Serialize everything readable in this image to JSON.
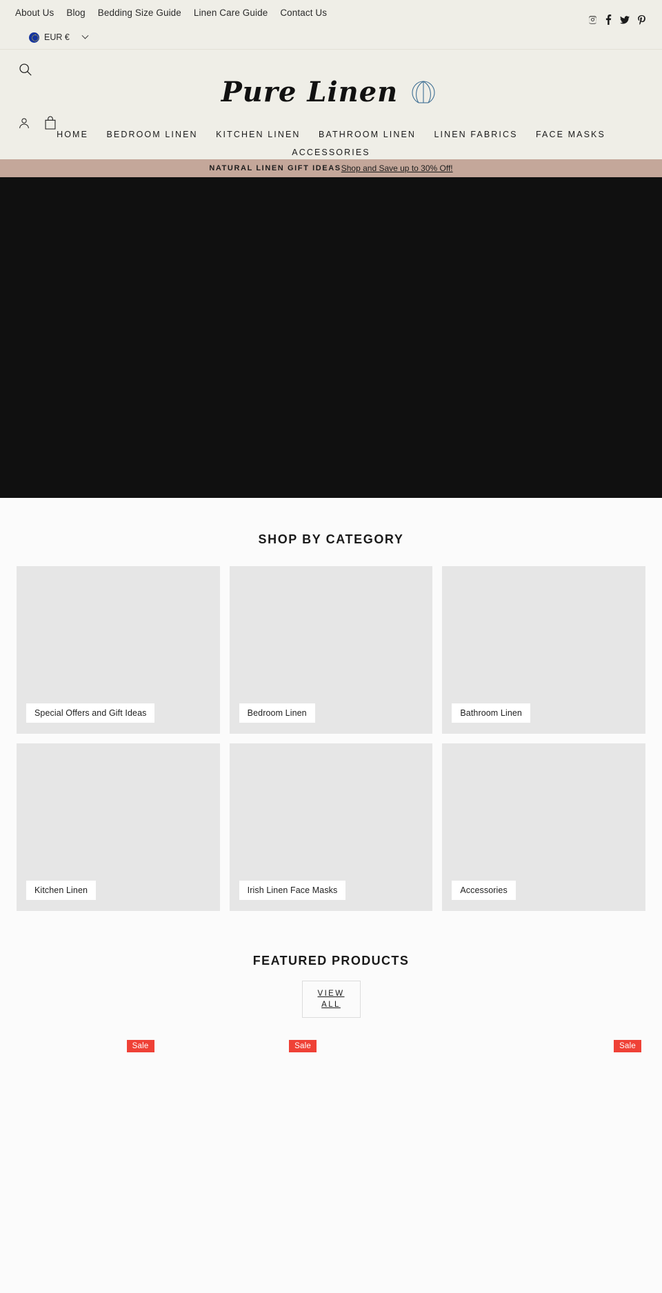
{
  "topbar": {
    "links": [
      {
        "label": "About Us"
      },
      {
        "label": "Blog"
      },
      {
        "label": "Bedding Size Guide"
      },
      {
        "label": "Linen Care Guide"
      },
      {
        "label": "Contact Us"
      }
    ],
    "currency": {
      "label": "EUR €",
      "flag_color": "#16359e"
    },
    "social": [
      {
        "name": "instagram-icon"
      },
      {
        "name": "facebook-icon"
      },
      {
        "name": "twitter-icon"
      },
      {
        "name": "pinterest-icon"
      }
    ]
  },
  "header": {
    "logo_text": "Pure Linen",
    "search_icon": "search-icon",
    "account_icon": "account-icon",
    "cart_icon": "cart-icon",
    "nav": [
      {
        "label": "HOME"
      },
      {
        "label": "BEDROOM LINEN"
      },
      {
        "label": "KITCHEN LINEN"
      },
      {
        "label": "BATHROOM LINEN"
      },
      {
        "label": "LINEN FABRICS"
      },
      {
        "label": "FACE MASKS"
      },
      {
        "label": "ACCESSORIES"
      }
    ]
  },
  "announcement": {
    "strong_text": "NATURAL LINEN GIFT IDEAS",
    "link_text": "Shop and Save up to 30% Off!",
    "background": "#c4a79a"
  },
  "hero": {
    "background": "#101010"
  },
  "shop_by_category": {
    "title": "SHOP BY CATEGORY",
    "cards": [
      {
        "label": "Special Offers and Gift Ideas"
      },
      {
        "label": "Bedroom Linen"
      },
      {
        "label": "Bathroom Linen"
      },
      {
        "label": "Kitchen Linen"
      },
      {
        "label": "Irish Linen Face Masks"
      },
      {
        "label": "Accessories"
      }
    ]
  },
  "featured_products": {
    "title": "FEATURED PRODUCTS",
    "view_all_line1": "VIEW",
    "view_all_line2": "ALL",
    "sale_badge_label": "Sale",
    "sale_badge_color": "#ef4136",
    "products": [
      {
        "sale": false
      },
      {
        "sale": true
      },
      {
        "sale": true
      },
      {
        "sale": false
      },
      {
        "sale": true
      }
    ]
  }
}
